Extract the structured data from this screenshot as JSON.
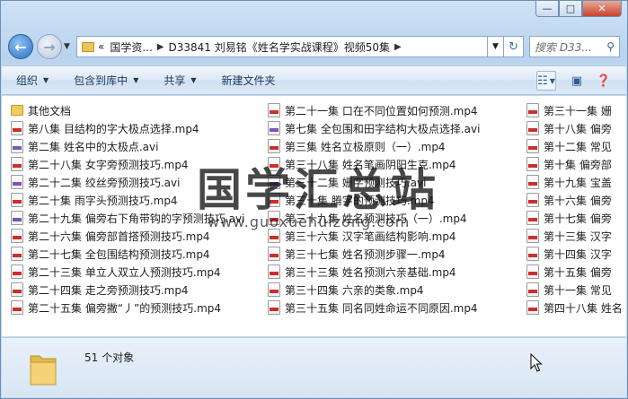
{
  "caption": {
    "minimize": "—",
    "maximize": "□",
    "close": "✕"
  },
  "nav": {
    "back_glyph": "←",
    "forward_glyph": "→",
    "address_prefix": "«",
    "breadcrumbs": [
      "国学资...",
      "D33841 刘易铭《姓名学实战课程》视频50集"
    ],
    "search_placeholder": "搜索 D33...",
    "refresh_glyph": "↻",
    "search_icon": "search-icon"
  },
  "toolbar": {
    "organize": "组织",
    "include_in_library": "包含到库中",
    "share": "共享",
    "new_folder": "新建文件夹"
  },
  "files": {
    "col1": [
      {
        "name": "其他文档",
        "type": "folder"
      },
      {
        "name": "第八集 目结构的字大极点选择.mp4",
        "type": "mp4"
      },
      {
        "name": "第二集 姓名中的太极点.avi",
        "type": "avi"
      },
      {
        "name": "第二十八集 女字旁预测技巧.mp4",
        "type": "mp4"
      },
      {
        "name": "第二十二集 绞丝旁预测技巧.avi",
        "type": "avi"
      },
      {
        "name": "第二十集 雨字头预测技巧.mp4",
        "type": "mp4"
      },
      {
        "name": "第二十九集 偏旁右下角带钩的字预测技巧.avi",
        "type": "avi"
      },
      {
        "name": "第二十六集 偏旁部首搭预测技巧.mp4",
        "type": "mp4"
      },
      {
        "name": "第二十七集 全包围结构预测技巧.mp4",
        "type": "mp4"
      },
      {
        "name": "第二十三集 单立人双立人预测技巧.mp4",
        "type": "mp4"
      },
      {
        "name": "第二十四集 走之旁预测技巧.mp4",
        "type": "mp4"
      },
      {
        "name": "第二十五集 偏旁撇“丿”的预测技巧.mp4",
        "type": "mp4"
      }
    ],
    "col2": [
      {
        "name": "第二十一集 口在不同位置如何预测.mp4",
        "type": "mp4"
      },
      {
        "name": "第七集 全包围和田字结构大极点选择.avi",
        "type": "avi"
      },
      {
        "name": "第三集 姓名立极原则（一）.mp4",
        "type": "mp4"
      },
      {
        "name": "第三十八集 姓名笔画阴阳生克.mp4",
        "type": "mp4"
      },
      {
        "name": "第三十二集 姗字预测技巧.avi",
        "type": "avi"
      },
      {
        "name": "第三十集 腾字的预测技巧.mp4",
        "type": "mp4"
      },
      {
        "name": "第三十九集 姓名预测技巧（一）.mp4",
        "type": "mp4"
      },
      {
        "name": "第三十六集 汉字笔画结构影响.mp4",
        "type": "mp4"
      },
      {
        "name": "第三十七集 姓名预测步骤一.mp4",
        "type": "mp4"
      },
      {
        "name": "第三十三集 姓名预测六亲基础.mp4",
        "type": "mp4"
      },
      {
        "name": "第三十四集 六亲的类象.mp4",
        "type": "mp4"
      },
      {
        "name": "第三十五集 同名同姓命运不同原因.mp4",
        "type": "mp4"
      }
    ],
    "col3": [
      {
        "name": "第三十一集 姗",
        "type": "mp4"
      },
      {
        "name": "第十八集 偏旁",
        "type": "mp4"
      },
      {
        "name": "第十二集 常见",
        "type": "mp4"
      },
      {
        "name": "第十集 偏旁部",
        "type": "mp4"
      },
      {
        "name": "第十九集 宝盖",
        "type": "mp4"
      },
      {
        "name": "第十六集 偏旁",
        "type": "mp4"
      },
      {
        "name": "第十七集 偏旁",
        "type": "mp4"
      },
      {
        "name": "第十三集 汉字",
        "type": "mp4"
      },
      {
        "name": "第十四集 汉字",
        "type": "mp4"
      },
      {
        "name": "第十五集 偏旁",
        "type": "mp4"
      },
      {
        "name": "第十一集 常见",
        "type": "mp4"
      },
      {
        "name": "第四十八集 姓名",
        "type": "mp4"
      }
    ]
  },
  "watermark": {
    "title": "国学汇总站",
    "url": "www.guoxuehuizong.com"
  },
  "status": {
    "count_text": "51 个对象"
  },
  "colors": {
    "mp4_stripe": "#c9302c",
    "avi_stripe": "#7a55b5",
    "folder": "#f0cb5c"
  }
}
